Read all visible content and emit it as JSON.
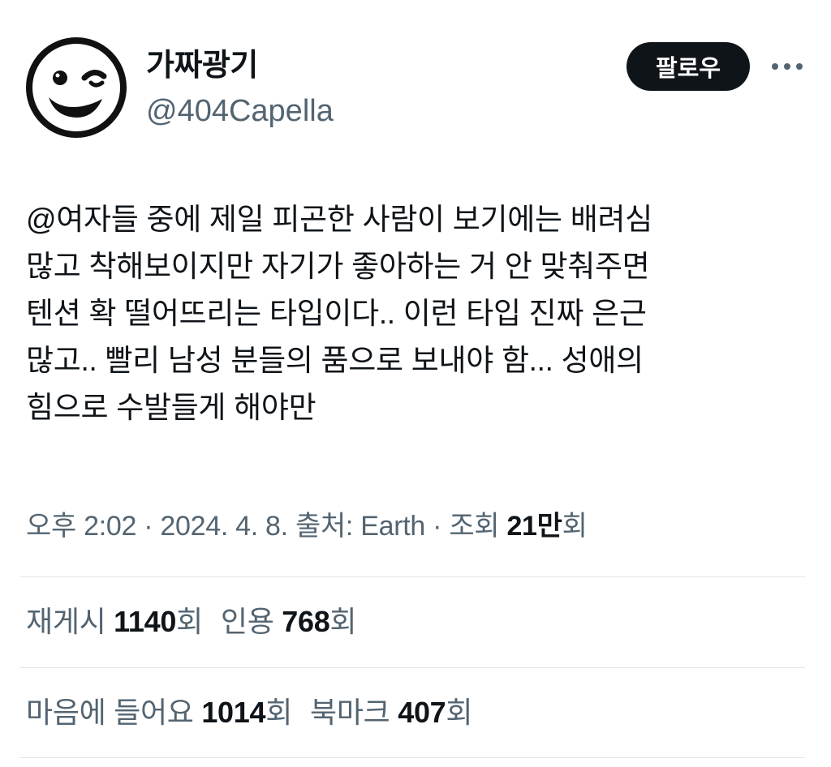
{
  "author": {
    "display_name": "가짜광기",
    "handle": "@404Capella",
    "avatar_icon": "winking-face-icon"
  },
  "header": {
    "follow_label": "팔로우",
    "more_icon": "more-dots-icon"
  },
  "tweet": {
    "text": "@여자들 중에 제일 피곤한 사람이 보기에는 배려심\n많고 착해보이지만 자기가 좋아하는 거 안 맞춰주면\n텐션 확 떨어뜨리는 타입이다.. 이런 타입 진짜 은근\n많고.. 빨리 남성 분들의 품으로 보내야 함... 성애의\n힘으로 수발들게 해야만"
  },
  "meta": {
    "time": "오후 2:02",
    "sep1": " · ",
    "date": "2024. 4. 8.",
    "sep2": " ",
    "source_label": "출처: Earth",
    "sep3": " · ",
    "views_label": "조회 ",
    "views_count": "21만",
    "views_unit": "회"
  },
  "stats": {
    "retweets_label": "재게시 ",
    "retweets_count": "1140",
    "retweets_unit": "회",
    "quotes_label": "인용 ",
    "quotes_count": "768",
    "quotes_unit": "회",
    "likes_label": "마음에 들어요 ",
    "likes_count": "1014",
    "likes_unit": "회",
    "bookmarks_label": "북마크 ",
    "bookmarks_count": "407",
    "bookmarks_unit": "회"
  },
  "colors": {
    "text_primary": "#0f1419",
    "text_secondary": "#536471",
    "divider": "#e1e6ea",
    "button_bg": "#0f1419",
    "button_text": "#ffffff"
  }
}
